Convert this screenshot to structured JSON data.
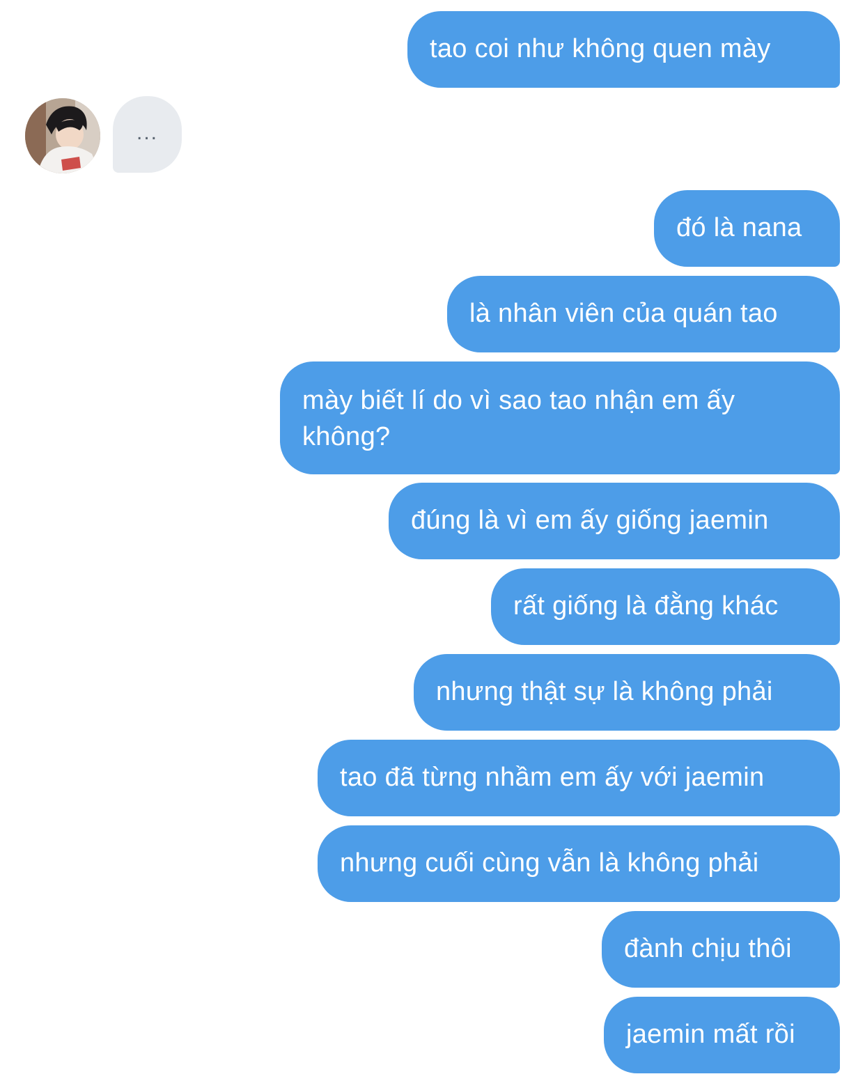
{
  "conversation": {
    "messages_sent": [
      {
        "text": "tao coi như không quen mày"
      },
      {
        "text": "đó là nana"
      },
      {
        "text": "là nhân viên của quán tao"
      },
      {
        "text": "mày biết lí do vì sao tao nhận em ấy không?"
      },
      {
        "text": "đúng là vì em ấy giống jaemin"
      },
      {
        "text": "rất giống là đằng khác"
      },
      {
        "text": "nhưng thật sự là không phải"
      },
      {
        "text": "tao đã từng nhầm em ấy với jaemin"
      },
      {
        "text": "nhưng cuối cùng vẫn là không phải"
      },
      {
        "text": "đành chịu thôi"
      },
      {
        "text": "jaemin mất rồi"
      }
    ],
    "typing_indicator": {
      "text": "...",
      "icon": "ellipsis-icon"
    },
    "contact_avatar": {
      "icon": "avatar-photo"
    }
  },
  "colors": {
    "sent_bubble": "#4d9de8",
    "received_bubble": "#e8ebef",
    "sent_text": "#ffffff"
  }
}
